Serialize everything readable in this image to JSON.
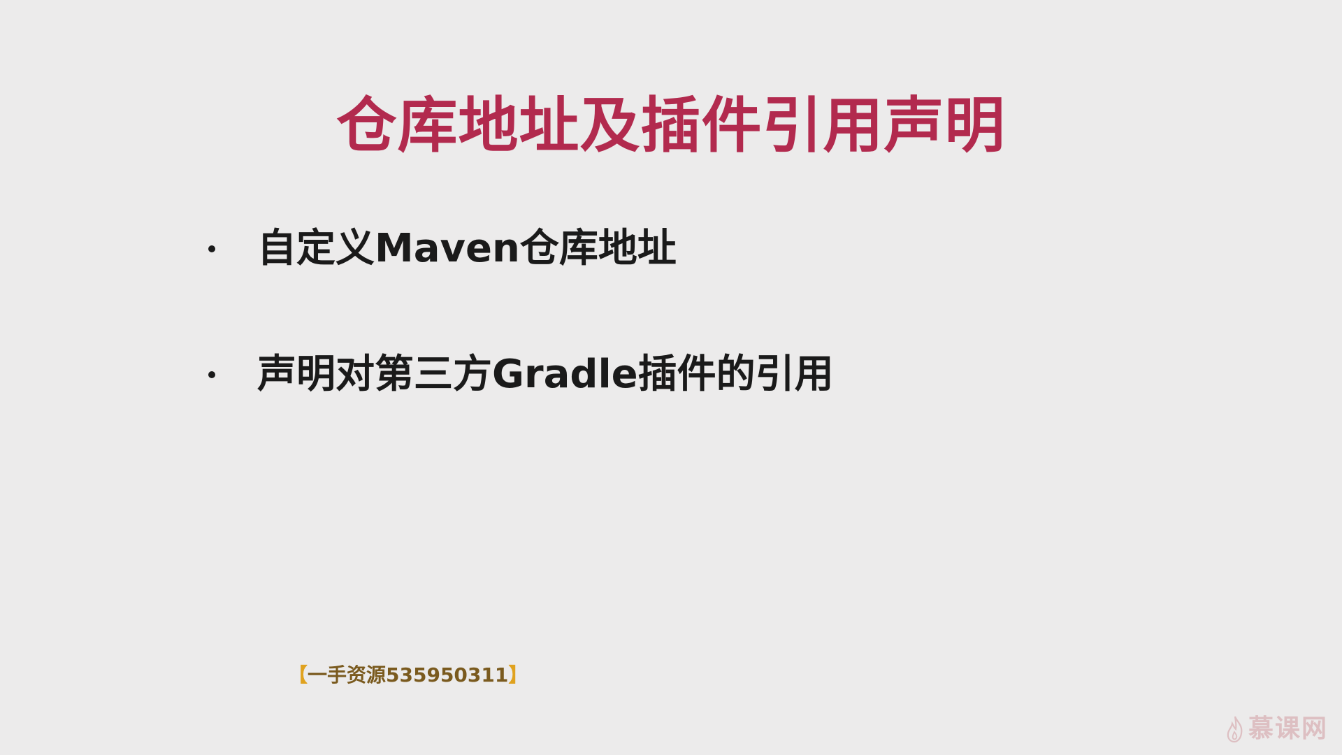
{
  "slide": {
    "title": "仓库地址及插件引用声明",
    "bullets": [
      {
        "text": "自定义Maven仓库地址"
      },
      {
        "text": "声明对第三方Gradle插件的引用"
      }
    ]
  },
  "watermark": {
    "open_bracket": "【",
    "text": "一手资源535950311",
    "close_bracket": "】"
  },
  "brand": {
    "logo_text": "慕课网",
    "icon": "flame-icon"
  },
  "colors": {
    "background": "#ECEBEB",
    "title": "#B22A4E",
    "body_text": "#1A1A1A",
    "watermark_text": "#7A5A1E",
    "watermark_bracket": "#E0A21E",
    "brand": "#DDBFC2"
  }
}
